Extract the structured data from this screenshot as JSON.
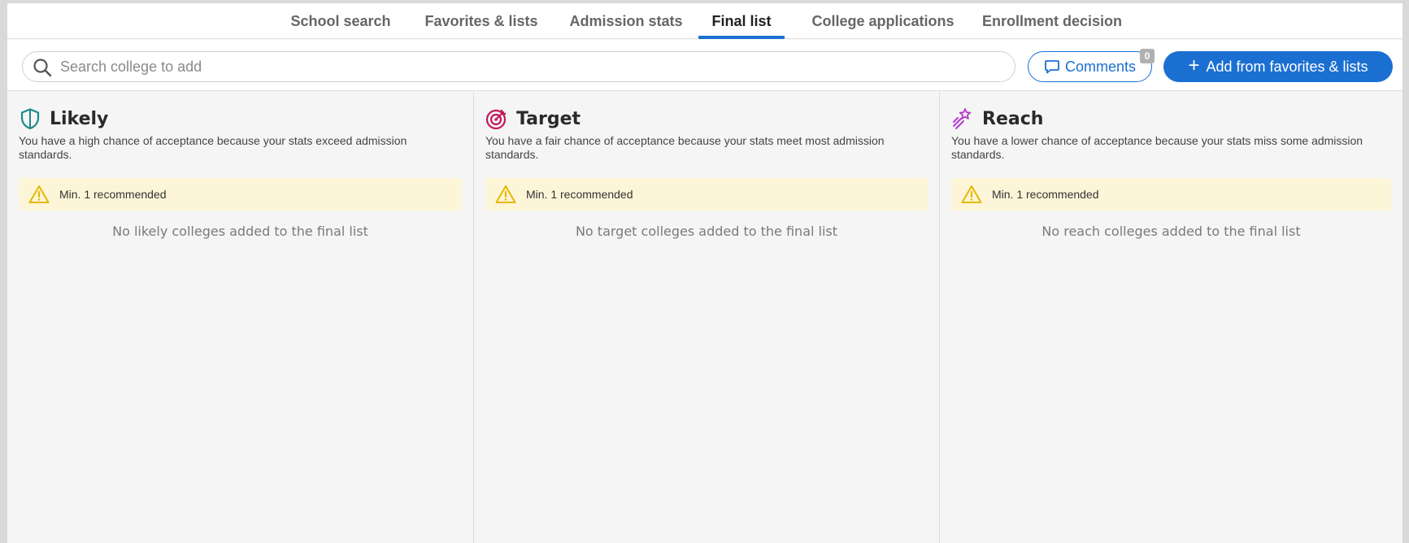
{
  "tabs": [
    {
      "label": "School search"
    },
    {
      "label": "Favorites & lists"
    },
    {
      "label": "Admission stats"
    },
    {
      "label": "Final list"
    },
    {
      "label": "College applications"
    },
    {
      "label": "Enrollment decision"
    }
  ],
  "active_tab": "Final list",
  "search": {
    "placeholder": "Search college to add",
    "icon": "search-icon"
  },
  "comments": {
    "label": "Comments",
    "count": "0",
    "icon": "comment-icon"
  },
  "add_button": {
    "label": "Add from favorites & lists",
    "icon": "plus-icon"
  },
  "columns": [
    {
      "title": "Likely",
      "icon": "shield-icon",
      "icon_color": "#1a8a8a",
      "description": "You have a high chance of acceptance because your stats exceed admission standards.",
      "warning": "Min. 1 recommended",
      "empty": "No likely colleges added to the final list"
    },
    {
      "title": "Target",
      "icon": "target-icon",
      "icon_color": "#c2185b",
      "description": "You have a fair chance of acceptance because your stats meet most admission standards.",
      "warning": "Min. 1 recommended",
      "empty": "No target colleges added to the final list"
    },
    {
      "title": "Reach",
      "icon": "magic-wand-icon",
      "icon_color": "#b43dc9",
      "description": "You have a lower chance of acceptance because your stats miss some admission standards.",
      "warning": "Min. 1 recommended",
      "empty": "No reach colleges added to the final list"
    }
  ],
  "colors": {
    "accent": "#1b6fd1",
    "warning_bg": "#fdf5d8",
    "warning_icon": "#e6b800"
  }
}
